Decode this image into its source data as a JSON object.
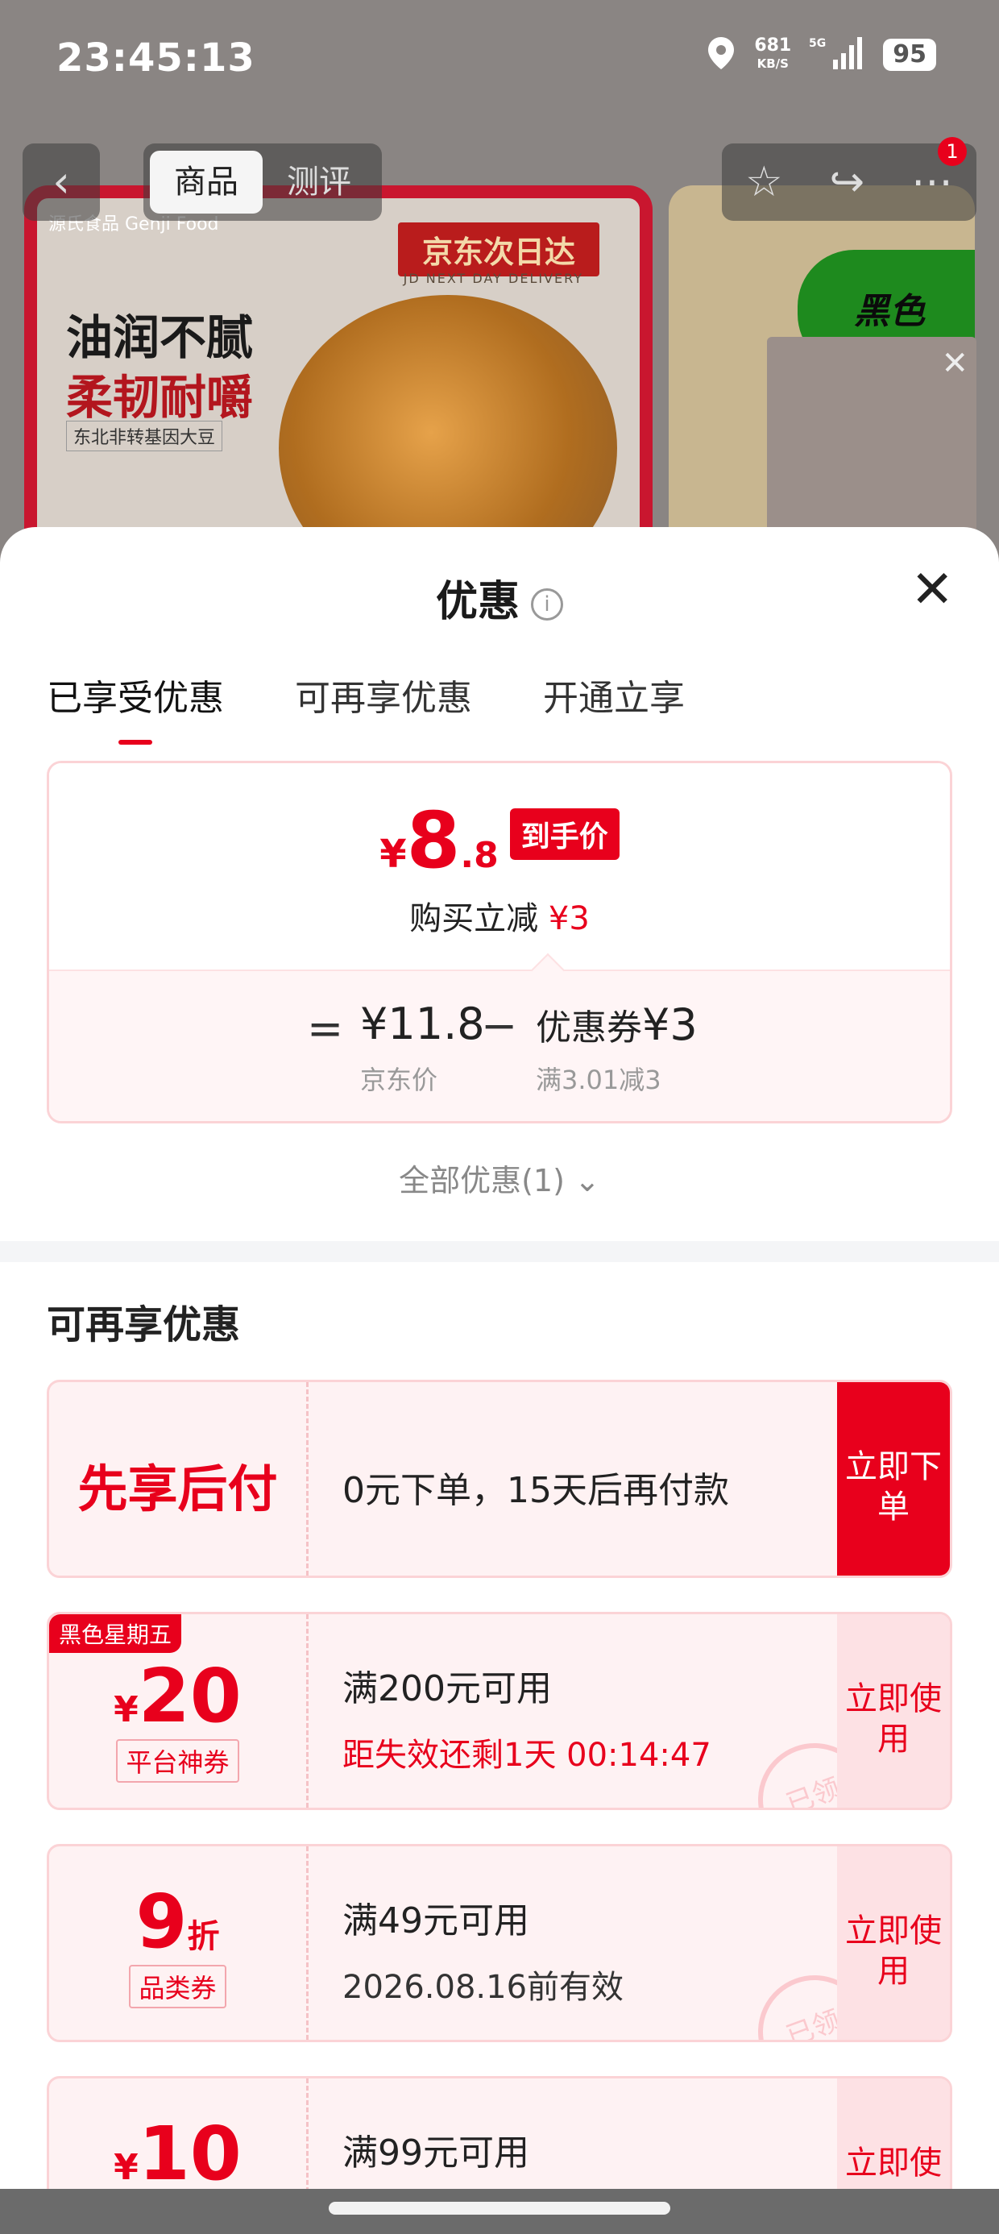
{
  "status_bar": {
    "time": "23:45:13",
    "net_speed": "681",
    "net_unit": "KB/S",
    "network": "5G",
    "battery": "95"
  },
  "product_nav": {
    "tabs": [
      "商品",
      "测评"
    ],
    "active_tab": "商品",
    "badge_count": "1",
    "icons": [
      "back-icon",
      "star-icon",
      "share-icon",
      "more-icon"
    ]
  },
  "banner": {
    "brand": "源氏食品 Genji Food",
    "delivery_tag": "京东次日达",
    "delivery_sub": "JD NEXT DAY DELIVERY",
    "headline_1": "油润不腻",
    "headline_2": "柔韧耐嚼",
    "note": "东北非转基因大豆",
    "side_label": "黑色"
  },
  "sheet": {
    "title": "优惠",
    "tabs": [
      "已享受优惠",
      "可再享优惠",
      "开通立享"
    ],
    "active_tab": "已享受优惠"
  },
  "price_card": {
    "currency": "¥",
    "final_int": "8",
    "final_dec": ".8",
    "final_tag": "到手价",
    "sub_prefix": "购买立减",
    "sub_amount": "¥3",
    "equals": "=",
    "jd_price": "¥11.8",
    "jd_label": "京东价",
    "minus": "−",
    "coupon_prefix": "优惠券",
    "coupon_amount": "¥3",
    "coupon_rule": "满3.01减3"
  },
  "all_deals": "全部优惠(1)",
  "section_title": "可再享优惠",
  "coupons": [
    {
      "left_text": "先享后付",
      "main": "0元下单，15天后再付款",
      "button": "立即下单"
    },
    {
      "badge": "黑色星期五",
      "amount_prefix": "¥",
      "amount": "20",
      "label": "平台神券",
      "main": "满200元可用",
      "sub": "距失效还剩1天 00:14:47",
      "button": "立即使用",
      "stamp": "已领"
    },
    {
      "amount": "9",
      "amount_suffix": "折",
      "label": "品类券",
      "main": "满49元可用",
      "sub": "2026.08.16前有效",
      "button": "立即使用",
      "stamp": "已领"
    },
    {
      "amount_prefix": "¥",
      "amount": "10",
      "main": "满99元可用",
      "button": "立即使用"
    }
  ],
  "colors": {
    "accent": "#e8001c",
    "coupon_bg": "#fef2f3",
    "coupon_border": "#fbd3d6"
  }
}
